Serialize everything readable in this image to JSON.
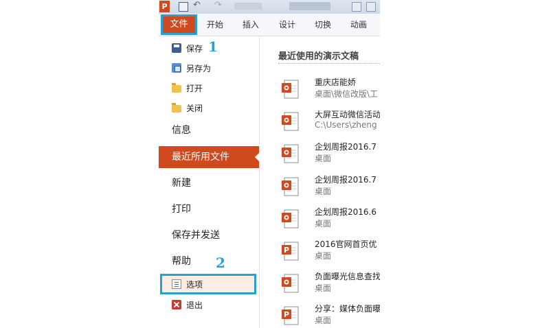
{
  "titlebar": {
    "app_icon": "P",
    "icons": [
      "powerpoint-app-icon",
      "save-icon",
      "undo-icon",
      "redo-icon"
    ]
  },
  "ribbon": {
    "file_tab": "文件",
    "tabs": [
      "开始",
      "插入",
      "设计",
      "切换",
      "动画"
    ]
  },
  "file_menu": {
    "items": [
      {
        "label": "保存",
        "icon": "save-icon"
      },
      {
        "label": "另存为",
        "icon": "save-as-icon"
      },
      {
        "label": "打开",
        "icon": "open-folder-icon"
      },
      {
        "label": "关闭",
        "icon": "close-folder-icon"
      }
    ],
    "info": "信息",
    "recent": "最近所用文件",
    "new": "新建",
    "print": "打印",
    "save_send": "保存并发送",
    "help": "帮助",
    "options": "选项",
    "exit": "退出"
  },
  "annotations": {
    "marker_1": "1",
    "marker_2": "2",
    "color": "#2a9fd6"
  },
  "recent": {
    "title": "最近使用的演示文稿",
    "files": [
      {
        "name": "重庆店能娇",
        "path": "桌面\\微信改版\\工",
        "type": "pptx"
      },
      {
        "name": "大屏互动微信活动",
        "path": "C:\\Users\\zheng",
        "type": "pptx"
      },
      {
        "name": "企划周报2016.7",
        "path": "桌面",
        "type": "pptx"
      },
      {
        "name": "企划周报2016.7",
        "path": "桌面",
        "type": "pptx"
      },
      {
        "name": "企划周报2016.6",
        "path": "桌面",
        "type": "pptx"
      },
      {
        "name": "2016官网首页优",
        "path": "桌面",
        "type": "ppt"
      },
      {
        "name": "负面曝光信息查找",
        "path": "桌面",
        "type": "pptx"
      },
      {
        "name": "分享：媒体负面曝",
        "path": "桌面",
        "type": "ppt"
      }
    ]
  },
  "colors": {
    "accent": "#d04a1f",
    "highlight": "#2a9fd6"
  }
}
